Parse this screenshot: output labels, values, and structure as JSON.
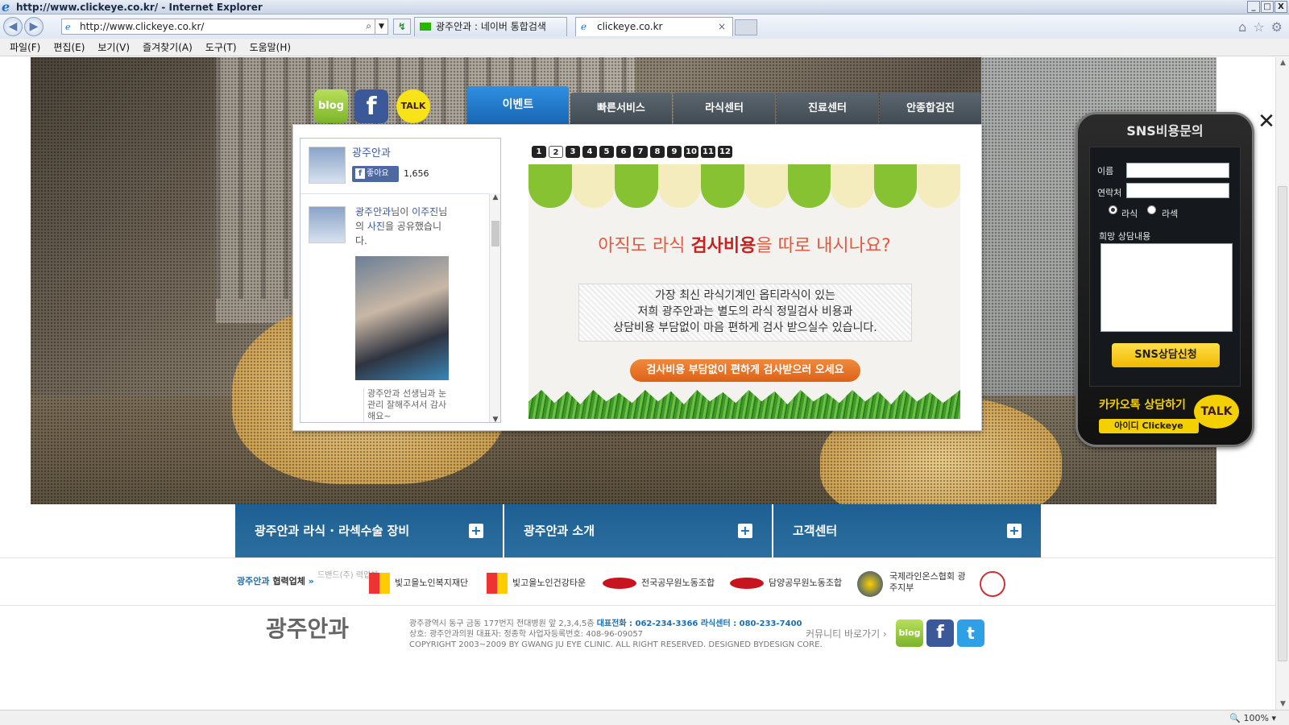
{
  "window": {
    "title": "http://www.clickeye.co.kr/ - Internet Explorer",
    "controls": [
      "_",
      "□",
      "X"
    ]
  },
  "addressbar": {
    "url": "http://www.clickeye.co.kr/",
    "tabs": [
      {
        "label": "광주안과 : 네이버 통합검색",
        "favicon_color": "#2db400"
      },
      {
        "label": "clickeye.co.kr",
        "close": "×"
      }
    ]
  },
  "menubar": [
    "파일(F)",
    "편집(E)",
    "보기(V)",
    "즐겨찾기(A)",
    "도구(T)",
    "도움말(H)"
  ],
  "sns_icons": {
    "blog": "blog",
    "facebook": "f",
    "kakao": "TALK"
  },
  "main_nav": {
    "active": "이벤트",
    "tabs": [
      "빠른서비스",
      "라식센터",
      "진료센터",
      "안종합검진"
    ]
  },
  "facebook_box": {
    "page_name": "광주안과",
    "like_label": "좋아요",
    "like_count": "1,656",
    "post_author": "광주안과",
    "post_text_1": "님이 ",
    "post_target": "이주진",
    "post_text_2": "님의 ",
    "post_link": "사진",
    "post_text_3": "을 공유했습니다.",
    "caption": "광주안과 선생님과 눈 관리 잘해주셔서 감사해요~"
  },
  "pager": [
    "1",
    "2",
    "3",
    "4",
    "5",
    "6",
    "7",
    "8",
    "9",
    "10",
    "11",
    "12"
  ],
  "pager_current": "2",
  "banner": {
    "headline_pre": "아직도 라식 ",
    "headline_bold": "검사비용",
    "headline_post": "을 따로 내시나요?",
    "desc": [
      "가장 최신 라식기계인 옵티라식이 있는",
      "저희 광주안과는 별도의 라식 정밀검사 비용과",
      "상담비용 부담없이 마음 편하게 검사 받으실수 있습니다."
    ],
    "cta": "검사비용 부담없이 편하게 검사받으러 오세요"
  },
  "sns_widget": {
    "title": "SNS비용문의",
    "name_label": "이름",
    "phone_label": "연락처",
    "radio1": "라식",
    "radio2": "라섹",
    "message_label": "희망 상담내용",
    "submit": "SNS상담신청",
    "kakao_title": "카카오톡 상담하기",
    "kakao_id": "아이디  Clickeye",
    "kakao_badge": "TALK"
  },
  "bottom_nav": [
    {
      "label": "광주안과 라식 · 라섹수술 장비",
      "plus": "+"
    },
    {
      "label": "광주안과 소개",
      "plus": "+"
    },
    {
      "label": "고객센터",
      "plus": "+"
    }
  ],
  "partners": {
    "label_pre": "광주안과",
    "label_bold": "협력업체",
    "faded": "드밴드(주) 력업체",
    "items": [
      "빛고을노인복지재단",
      "빛고을노인건강타운",
      "전국공무원노동조합",
      "담양공무원노동조합",
      "국제라인온스협회 광주지부"
    ]
  },
  "footer": {
    "logo": "광주안과",
    "addr_line1": "광주광역시 동구 금동 177번지 전대병원 앞 2,3,4,5층",
    "addr_tel_label": "대표전화 : 062-234-3366 라식센터 : 080-233-7400",
    "addr_line2": "상호: 광주안과의원    대표자:  정종학    사업자등록번호: 408-96-09057",
    "addr_line3": "COPYRIGHT 2003~2009 BY GWANG JU EYE CLINIC. ALL RIGHT RESERVED. DESIGNED BYDESIGN CORE.",
    "community": "커뮤니티 바로가기  ›",
    "icons": [
      "blog",
      "f",
      "t"
    ]
  },
  "status": {
    "zoom": "100%"
  }
}
